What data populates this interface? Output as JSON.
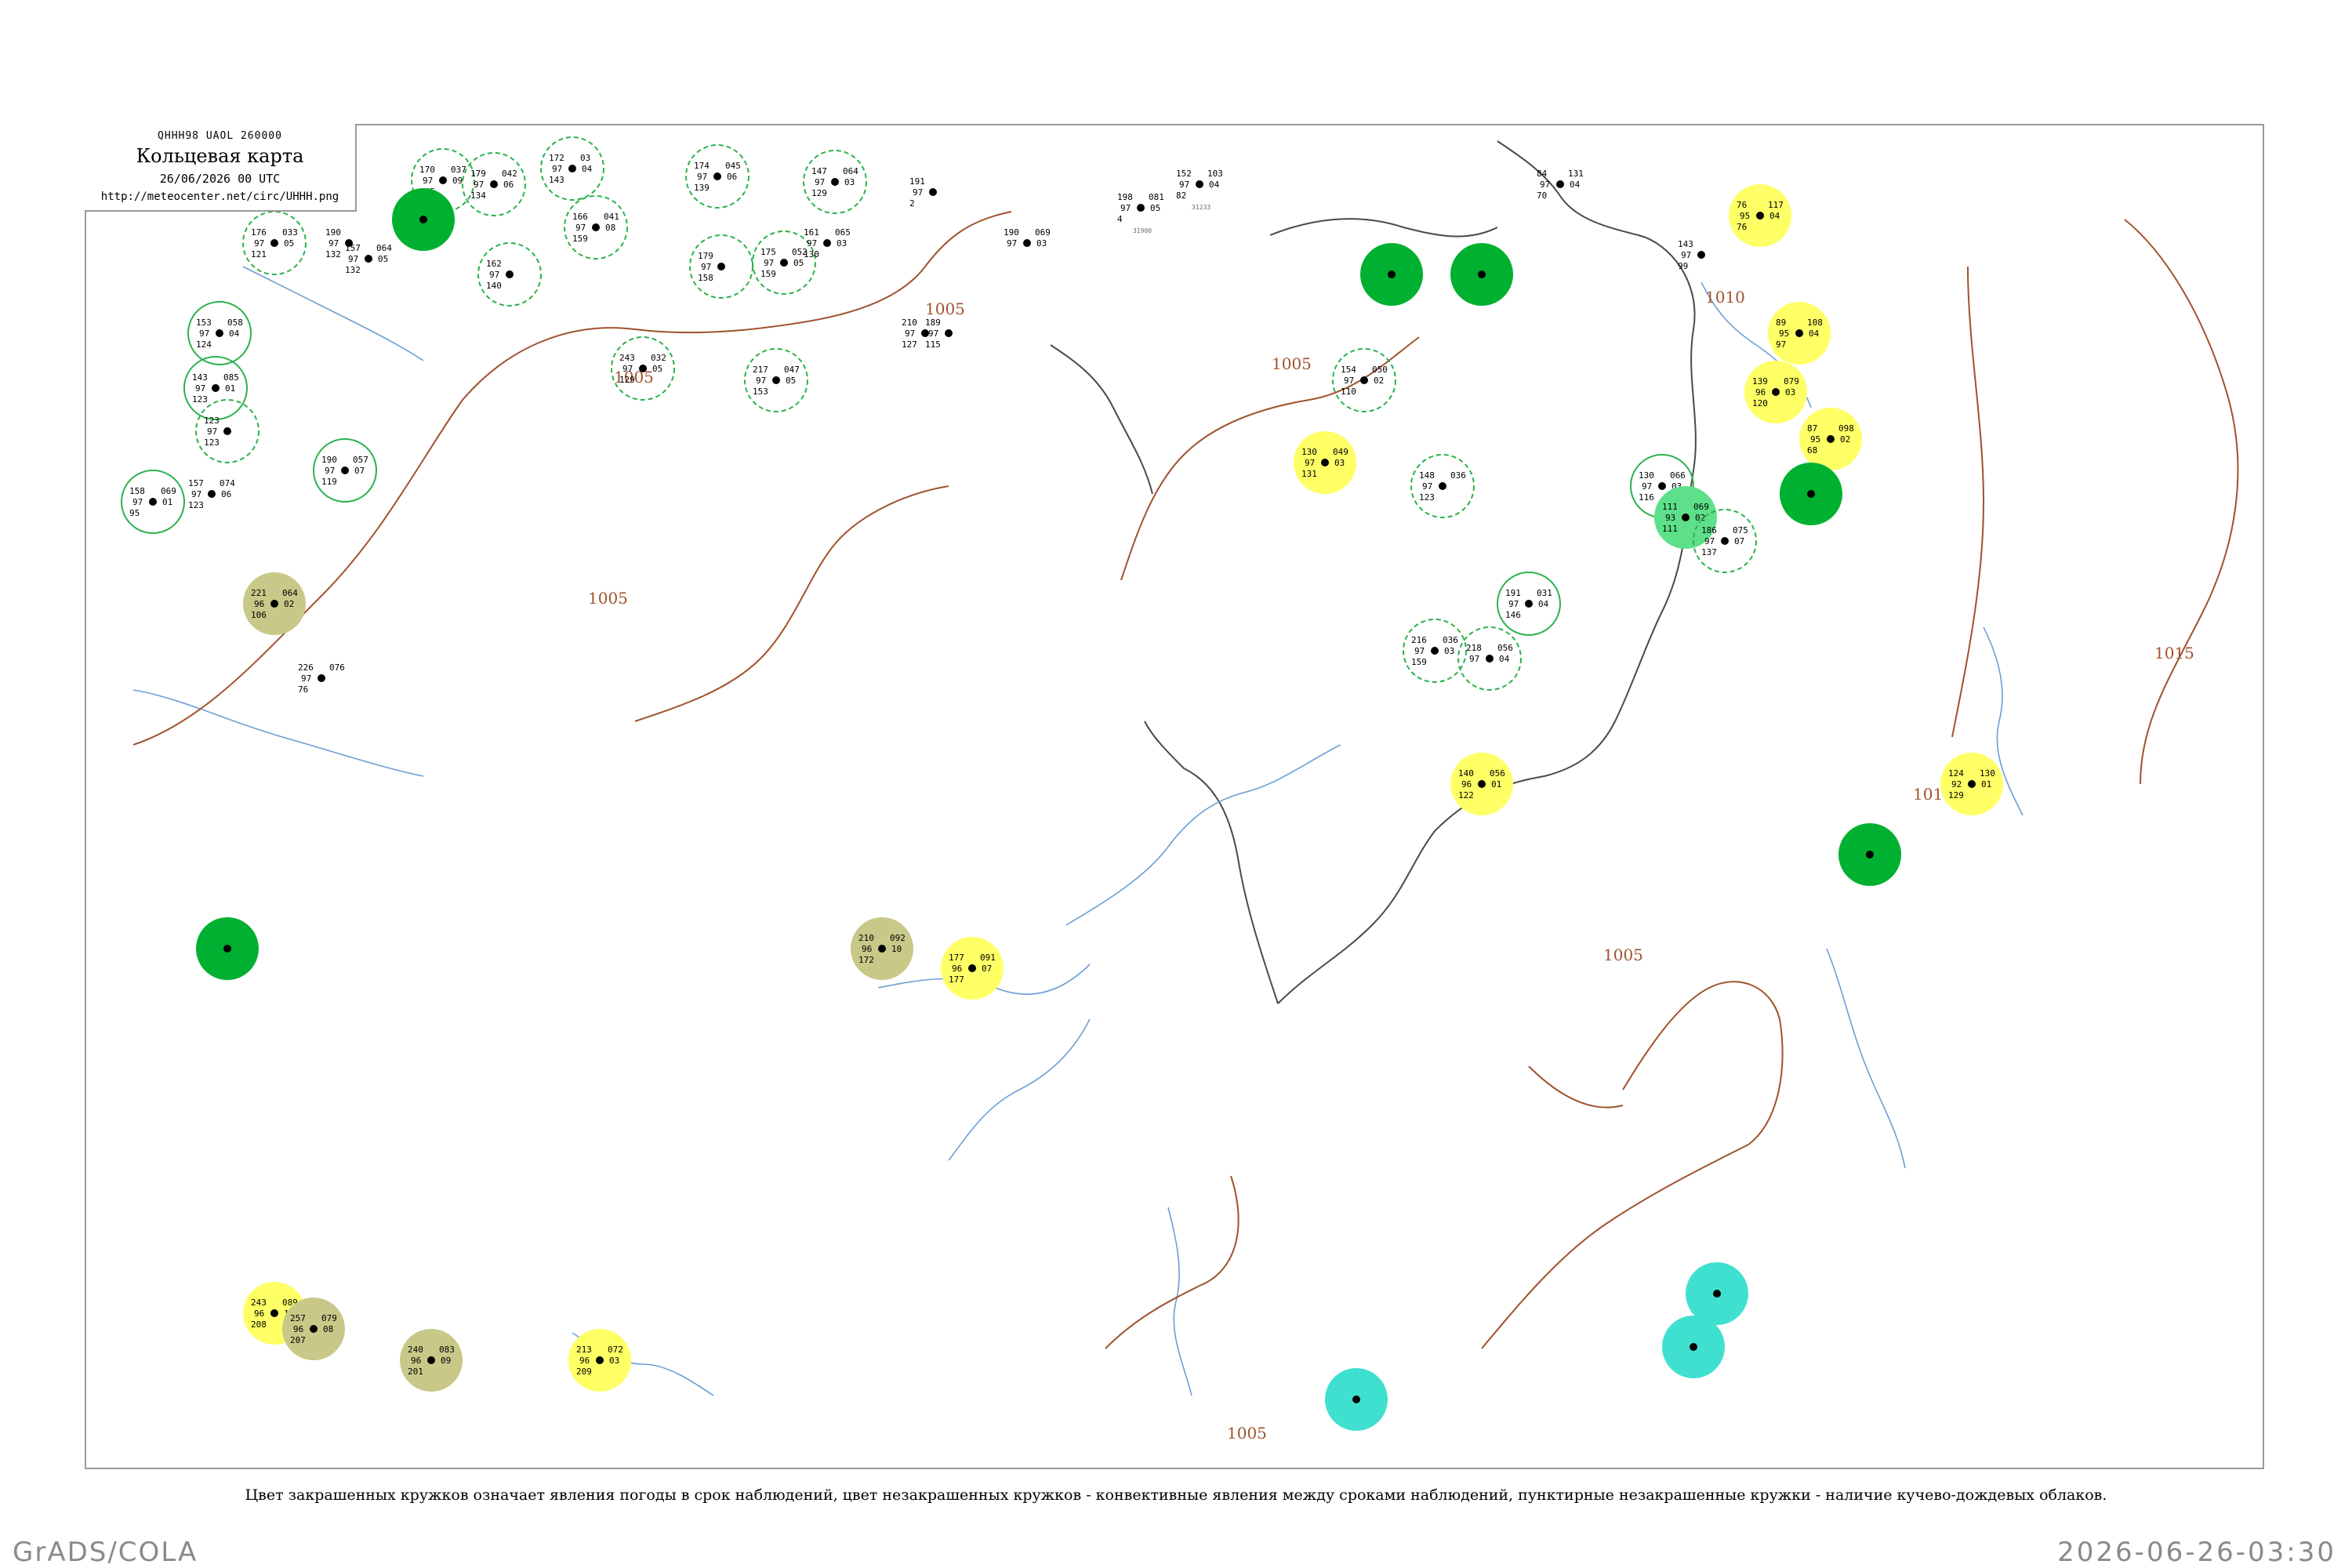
{
  "header": {
    "code": "QHHH98  UAOL  260000",
    "title": "Кольцевая карта",
    "datetime": "26/06/2026 00 UTC",
    "url": "http://meteocenter.net/circ/UHHH.png"
  },
  "caption": "Цвет закрашенных кружков означает явления погоды в срок наблюдений, цвет незакрашенных кружков - конвективные явления между сроками наблюдений, пунктирные незакрашенные кружки - наличие кучево-дождевых облаков.",
  "footer": {
    "left": "GrADS/COLA",
    "right": "2026-06-26-03:30"
  },
  "colors": {
    "isobar": "#a0522d",
    "rivers": "#6b9fd6",
    "coast": "#4a4a4a",
    "rain": "#00b030",
    "light_rain": "#5ee08a",
    "fog": "#ffff66",
    "haze": "#c8c888",
    "shower": "#40e0d0",
    "thunder_ring": "#2bb24c"
  },
  "isobar_labels": [
    "1005",
    "1005",
    "1005",
    "1005",
    "1005",
    "1005",
    "1010",
    "1010",
    "1015"
  ],
  "stations": [
    {
      "p": "172",
      "t": "97",
      "d": "143",
      "k": "03",
      "c": "04",
      "id": "",
      "fill": "none",
      "ring": "dash"
    },
    {
      "p": "170",
      "t": "97",
      "d": "145",
      "k": "037",
      "c": "09",
      "id": "",
      "fill": "none",
      "ring": "dash"
    },
    {
      "p": "179",
      "t": "97",
      "d": "134",
      "k": "042",
      "c": "06",
      "id": "",
      "fill": "none",
      "ring": "dash"
    },
    {
      "p": "174",
      "t": "97",
      "d": "139",
      "k": "045",
      "c": "06",
      "id": "",
      "fill": "none",
      "ring": "dash"
    },
    {
      "p": "147",
      "t": "97",
      "d": "129",
      "k": "064",
      "c": "03",
      "id": "",
      "fill": "none",
      "ring": "dash"
    },
    {
      "p": "191",
      "t": "97",
      "d": "2",
      "k": "",
      "c": "",
      "id": "",
      "fill": "none",
      "ring": "none"
    },
    {
      "p": "152",
      "t": "97",
      "d": "82",
      "k": "103",
      "c": "04",
      "id": "31233",
      "fill": "none",
      "ring": "none"
    },
    {
      "p": "84",
      "t": "97",
      "d": "70",
      "k": "131",
      "c": "04",
      "id": "",
      "fill": "none",
      "ring": "none"
    },
    {
      "p": "76",
      "t": "95",
      "d": "76",
      "k": "117",
      "c": "04",
      "id": "",
      "fill": "fog",
      "ring": "none"
    },
    {
      "p": "176",
      "t": "97",
      "d": "121",
      "k": "033",
      "c": "05",
      "id": "",
      "fill": "none",
      "ring": "dash"
    },
    {
      "p": "190",
      "t": "97",
      "d": "132",
      "k": "",
      "c": "",
      "id": "",
      "fill": "none",
      "ring": "none"
    },
    {
      "p": "157",
      "t": "97",
      "d": "132",
      "k": "064",
      "c": "05",
      "id": "",
      "fill": "none",
      "ring": "none"
    },
    {
      "p": "",
      "t": "",
      "d": "",
      "k": "",
      "c": "",
      "id": "",
      "fill": "rain",
      "ring": "none"
    },
    {
      "p": "162",
      "t": "97",
      "d": "140",
      "k": "",
      "c": "",
      "id": "",
      "fill": "none",
      "ring": "dash"
    },
    {
      "p": "166",
      "t": "97",
      "d": "159",
      "k": "041",
      "c": "08",
      "id": "",
      "fill": "none",
      "ring": "dash"
    },
    {
      "p": "179",
      "t": "97",
      "d": "158",
      "k": "",
      "c": "",
      "id": "",
      "fill": "none",
      "ring": "dash"
    },
    {
      "p": "175",
      "t": "97",
      "d": "159",
      "k": "052",
      "c": "05",
      "id": "",
      "fill": "none",
      "ring": "dash"
    },
    {
      "p": "161",
      "t": "97",
      "d": "130",
      "k": "065",
      "c": "03",
      "id": "",
      "fill": "none",
      "ring": "none"
    },
    {
      "p": "190",
      "t": "97",
      "d": "",
      "k": "069",
      "c": "03",
      "id": "",
      "fill": "none",
      "ring": "none"
    },
    {
      "p": "198",
      "t": "97",
      "d": "4",
      "k": "081",
      "c": "05",
      "id": "31900",
      "fill": "none",
      "ring": "none"
    },
    {
      "p": "",
      "t": "",
      "d": "",
      "k": "",
      "c": "",
      "id": "",
      "fill": "rain",
      "ring": "none"
    },
    {
      "p": "",
      "t": "",
      "d": "",
      "k": "",
      "c": "",
      "id": "",
      "fill": "rain",
      "ring": "none"
    },
    {
      "p": "143",
      "t": "97",
      "d": "99",
      "k": "",
      "c": "",
      "id": "",
      "fill": "none",
      "ring": "none"
    },
    {
      "p": "89",
      "t": "95",
      "d": "97",
      "k": "108",
      "c": "04",
      "id": "",
      "fill": "fog",
      "ring": "none"
    },
    {
      "p": "153",
      "t": "97",
      "d": "124",
      "k": "058",
      "c": "04",
      "id": "",
      "fill": "none",
      "ring": "solid"
    },
    {
      "p": "143",
      "t": "97",
      "d": "123",
      "k": "085",
      "c": "01",
      "id": "",
      "fill": "none",
      "ring": "solid"
    },
    {
      "p": "123",
      "t": "97",
      "d": "123",
      "k": "",
      "c": "",
      "id": "",
      "fill": "none",
      "ring": "dash"
    },
    {
      "p": "189",
      "t": "97",
      "d": "115",
      "k": "",
      "c": "",
      "id": "",
      "fill": "none",
      "ring": "none"
    },
    {
      "p": "210",
      "t": "97",
      "d": "127",
      "k": "",
      "c": "",
      "id": "",
      "fill": "none",
      "ring": "none"
    },
    {
      "p": "217",
      "t": "97",
      "d": "153",
      "k": "047",
      "c": "05",
      "id": "",
      "fill": "none",
      "ring": "dash"
    },
    {
      "p": "243",
      "t": "97",
      "d": "129",
      "k": "032",
      "c": "05",
      "id": "",
      "fill": "none",
      "ring": "dash"
    },
    {
      "p": "154",
      "t": "97",
      "d": "110",
      "k": "050",
      "c": "02",
      "id": "",
      "fill": "none",
      "ring": "dash"
    },
    {
      "p": "139",
      "t": "96",
      "d": "120",
      "k": "079",
      "c": "03",
      "id": "",
      "fill": "fog",
      "ring": "none"
    },
    {
      "p": "87",
      "t": "95",
      "d": "68",
      "k": "098",
      "c": "02",
      "id": "",
      "fill": "fog",
      "ring": "none"
    },
    {
      "p": "158",
      "t": "97",
      "d": "95",
      "k": "069",
      "c": "01",
      "id": "",
      "fill": "none",
      "ring": "solid"
    },
    {
      "p": "190",
      "t": "97",
      "d": "119",
      "k": "057",
      "c": "07",
      "id": "",
      "fill": "none",
      "ring": "solid"
    },
    {
      "p": "157",
      "t": "97",
      "d": "123",
      "k": "074",
      "c": "06",
      "id": "",
      "fill": "none",
      "ring": "none"
    },
    {
      "p": "",
      "t": "",
      "d": "",
      "k": "",
      "c": "",
      "id": "",
      "fill": "rain",
      "ring": "none"
    },
    {
      "p": "130",
      "t": "97",
      "d": "116",
      "k": "066",
      "c": "03",
      "id": "",
      "fill": "none",
      "ring": "solid"
    },
    {
      "p": "111",
      "t": "93",
      "d": "111",
      "k": "069",
      "c": "02",
      "id": "",
      "fill": "light_rain",
      "ring": "none"
    },
    {
      "p": "186",
      "t": "97",
      "d": "137",
      "k": "075",
      "c": "07",
      "id": "",
      "fill": "none",
      "ring": "dash"
    },
    {
      "p": "130",
      "t": "97",
      "d": "131",
      "k": "049",
      "c": "03",
      "id": "",
      "fill": "fog",
      "ring": "none"
    },
    {
      "p": "148",
      "t": "97",
      "d": "123",
      "k": "036",
      "c": "",
      "id": "",
      "fill": "none",
      "ring": "dash"
    },
    {
      "p": "221",
      "t": "96",
      "d": "106",
      "k": "064",
      "c": "02",
      "id": "",
      "fill": "haze",
      "ring": "none"
    },
    {
      "p": "226",
      "t": "97",
      "d": "76",
      "k": "076",
      "c": "",
      "id": "",
      "fill": "none",
      "ring": "none"
    },
    {
      "p": "191",
      "t": "97",
      "d": "146",
      "k": "031",
      "c": "04",
      "id": "",
      "fill": "none",
      "ring": "solid"
    },
    {
      "p": "216",
      "t": "97",
      "d": "159",
      "k": "036",
      "c": "03",
      "id": "",
      "fill": "none",
      "ring": "dash"
    },
    {
      "p": "218",
      "t": "97",
      "d": "",
      "k": "056",
      "c": "04",
      "id": "",
      "fill": "none",
      "ring": "dash"
    },
    {
      "p": "140",
      "t": "96",
      "d": "122",
      "k": "056",
      "c": "01",
      "id": "",
      "fill": "fog",
      "ring": "none"
    },
    {
      "p": "124",
      "t": "92",
      "d": "129",
      "k": "130",
      "c": "01",
      "id": "",
      "fill": "fog",
      "ring": "none"
    },
    {
      "p": "210",
      "t": "96",
      "d": "172",
      "k": "092",
      "c": "10",
      "id": "",
      "fill": "haze",
      "ring": "none"
    },
    {
      "p": "177",
      "t": "96",
      "d": "177",
      "k": "091",
      "c": "07",
      "id": "",
      "fill": "fog",
      "ring": "none"
    },
    {
      "p": "",
      "t": "",
      "d": "",
      "k": "",
      "c": "",
      "id": "",
      "fill": "rain",
      "ring": "none"
    },
    {
      "p": "",
      "t": "",
      "d": "",
      "k": "",
      "c": "",
      "id": "",
      "fill": "rain",
      "ring": "none"
    },
    {
      "p": "243",
      "t": "96",
      "d": "208",
      "k": "089",
      "c": "11",
      "id": "",
      "fill": "fog",
      "ring": "none"
    },
    {
      "p": "257",
      "t": "96",
      "d": "207",
      "k": "079",
      "c": "08",
      "id": "",
      "fill": "haze",
      "ring": "none"
    },
    {
      "p": "240",
      "t": "96",
      "d": "201",
      "k": "083",
      "c": "09",
      "id": "",
      "fill": "haze",
      "ring": "none"
    },
    {
      "p": "213",
      "t": "96",
      "d": "209",
      "k": "072",
      "c": "03",
      "id": "",
      "fill": "fog",
      "ring": "none"
    },
    {
      "p": "",
      "t": "",
      "d": "",
      "k": "",
      "c": "",
      "id": "",
      "fill": "shower",
      "ring": "none"
    },
    {
      "p": "",
      "t": "",
      "d": "",
      "k": "",
      "c": "",
      "id": "",
      "fill": "shower",
      "ring": "none"
    },
    {
      "p": "",
      "t": "",
      "d": "",
      "k": "",
      "c": "",
      "id": "",
      "fill": "shower",
      "ring": "none"
    }
  ]
}
